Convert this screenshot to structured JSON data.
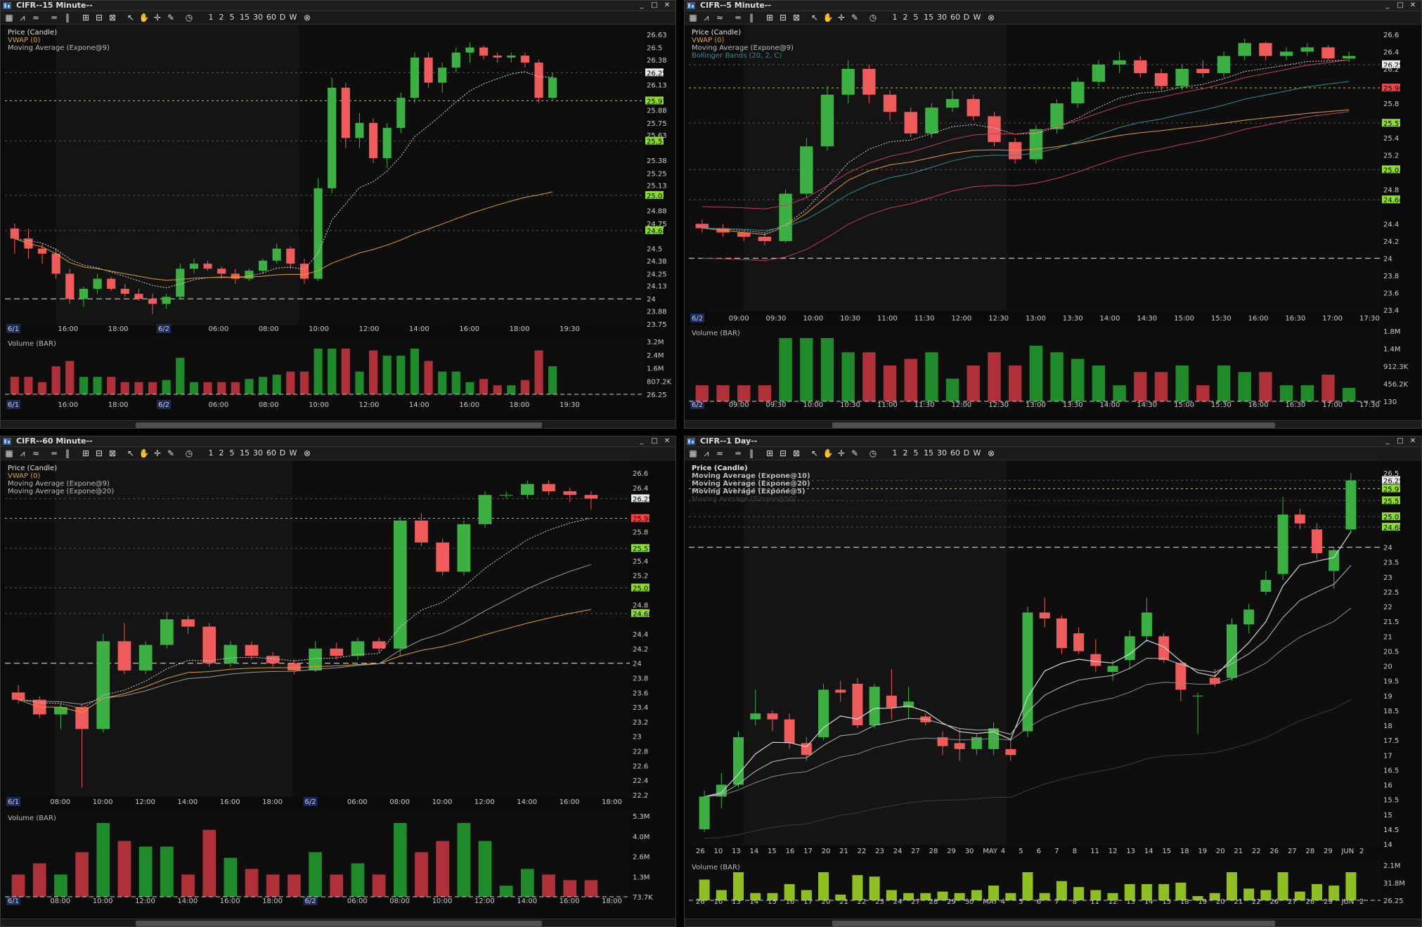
{
  "colors": {
    "up": "#3cb043",
    "down": "#ef5a5a",
    "vwap": "#e0a020",
    "ma9": "#d8d8d8",
    "ma20": "#9a9a9a",
    "bb": "#c0405a",
    "bbmid": "#2f8f8f",
    "price_tag_green": "#8cde2a",
    "price_tag_red": "#ff4040"
  },
  "toolbar": {
    "periods": [
      "1",
      "2",
      "5",
      "15",
      "30",
      "60",
      "D",
      "W"
    ]
  },
  "panes": [
    {
      "title": "CIFR--15 Minute--",
      "legend": [
        "Price (Candle)",
        "VWAP (0)",
        "Moving Average (Expone@9)"
      ],
      "price_ticks": [
        "26.63",
        "26.5",
        "26.38",
        "26.25",
        "26.13",
        "25.97",
        "25.88",
        "25.75",
        "25.63",
        "25.57",
        "25.38",
        "25.25",
        "25.13",
        "25.03",
        "24.88",
        "24.75",
        "24.68",
        "24.5",
        "24.38",
        "24.25",
        "24.13",
        "24",
        "23.88",
        "23.75"
      ],
      "time_labels": [
        "6/1",
        "16:00",
        "18:00",
        "6/2",
        "06:00",
        "08:00",
        "10:00",
        "12:00",
        "14:00",
        "16:00",
        "18:00",
        "19:30"
      ],
      "volume_label": "Volume (BAR)",
      "volume_ticks": [
        "3.2M",
        "2.4M",
        "1.6M",
        "807.2K",
        "26.25"
      ]
    },
    {
      "title": "CIFR--5 Minute--",
      "legend": [
        "Price (Candle)",
        "VWAP (0)",
        "Moving Average (Expone@9)",
        "Bollinger Bands (20, 2, C)"
      ],
      "price_ticks": [
        "26.6",
        "26.4",
        "26.25",
        "26.2",
        "25.98",
        "25.8",
        "25.57",
        "25.4",
        "25.2",
        "25.03",
        "24.8",
        "24.68",
        "24.4",
        "24.2",
        "24",
        "23.8",
        "23.6",
        "23.4"
      ],
      "time_labels": [
        "6/2",
        "09:00",
        "09:30",
        "10:00",
        "10:30",
        "11:00",
        "11:30",
        "12:00",
        "12:30",
        "13:00",
        "13:30",
        "14:00",
        "14:30",
        "15:00",
        "15:30",
        "16:00",
        "16:30",
        "17:00",
        "17:30"
      ],
      "volume_label": "Volume (BAR)",
      "volume_ticks": [
        "1.8M",
        "1.4M",
        "912.3K",
        "456.2K",
        "130"
      ]
    },
    {
      "title": "CIFR--60 Minute--",
      "legend": [
        "Price (Candle)",
        "VWAP (0)",
        "Moving Average (Expone@9)",
        "Moving Average (Expone@20)"
      ],
      "price_ticks": [
        "26.6",
        "26.4",
        "26.25",
        "25.98",
        "25.8",
        "25.57",
        "25.4",
        "25.2",
        "25.03",
        "24.8",
        "24.68",
        "24.4",
        "24.2",
        "24",
        "23.8",
        "23.6",
        "23.4",
        "23.2",
        "23",
        "22.8",
        "22.6",
        "22.4",
        "22.2"
      ],
      "time_labels": [
        "6/1",
        "08:00",
        "10:00",
        "12:00",
        "14:00",
        "16:00",
        "18:00",
        "6/2",
        "06:00",
        "08:00",
        "10:00",
        "12:00",
        "14:00",
        "16:00",
        "18:00"
      ],
      "volume_label": "Volume (BAR)",
      "volume_ticks": [
        "5.3M",
        "4.0M",
        "2.6M",
        "1.3M",
        "73.7K"
      ]
    },
    {
      "title": "CIFR--1 Day--",
      "legend": [
        "Price (Candle)",
        "Moving Average (Expone@10)",
        "Moving Average (Expone@20)",
        "Moving Average (Expone@5)",
        "Moving Average (Simple@50)"
      ],
      "price_ticks": [
        "26.5",
        "26.25",
        "25.97",
        "25.57",
        "25.03",
        "24.68",
        "24",
        "23.5",
        "23",
        "22.5",
        "22",
        "21.5",
        "21",
        "20.5",
        "20",
        "19.5",
        "19",
        "18.5",
        "18",
        "17.5",
        "17",
        "16.5",
        "16",
        "15.5",
        "15",
        "14.5",
        "14"
      ],
      "time_labels": [
        "26",
        "10",
        "13",
        "14",
        "15",
        "16",
        "17",
        "20",
        "21",
        "22",
        "23",
        "24",
        "27",
        "28",
        "29",
        "30",
        "MAY",
        "4",
        "5",
        "6",
        "7",
        "8",
        "11",
        "12",
        "13",
        "14",
        "15",
        "18",
        "19",
        "20",
        "21",
        "22",
        "26",
        "27",
        "28",
        "29",
        "JUN",
        "2"
      ],
      "volume_label": "Volume (BAR)",
      "volume_ticks": [
        "2.1M",
        "31.8M",
        "26.25"
      ]
    }
  ],
  "chart_data": [
    {
      "type": "candlestick",
      "title": "CIFR--15 Minute--",
      "ylim": [
        23.75,
        26.63
      ],
      "ohlc": [
        [
          24.7,
          24.75,
          24.45,
          24.6
        ],
        [
          24.6,
          24.7,
          24.4,
          24.5
        ],
        [
          24.5,
          24.55,
          24.35,
          24.45
        ],
        [
          24.45,
          24.5,
          24.2,
          24.25
        ],
        [
          24.25,
          24.3,
          23.95,
          24.0
        ],
        [
          24.0,
          24.12,
          23.92,
          24.1
        ],
        [
          24.1,
          24.25,
          24.05,
          24.2
        ],
        [
          24.2,
          24.22,
          24.08,
          24.1
        ],
        [
          24.1,
          24.15,
          24.02,
          24.05
        ],
        [
          24.05,
          24.1,
          23.98,
          24.0
        ],
        [
          24.0,
          24.05,
          23.85,
          23.95
        ],
        [
          23.95,
          24.05,
          23.9,
          24.02
        ],
        [
          24.02,
          24.35,
          24.0,
          24.3
        ],
        [
          24.3,
          24.4,
          24.25,
          24.35
        ],
        [
          24.35,
          24.38,
          24.28,
          24.3
        ],
        [
          24.3,
          24.32,
          24.2,
          24.25
        ],
        [
          24.25,
          24.3,
          24.15,
          24.2
        ],
        [
          24.2,
          24.3,
          24.18,
          24.28
        ],
        [
          24.28,
          24.4,
          24.25,
          24.38
        ],
        [
          24.38,
          24.55,
          24.35,
          24.5
        ],
        [
          24.5,
          24.52,
          24.3,
          24.35
        ],
        [
          24.35,
          24.4,
          24.15,
          24.2
        ],
        [
          24.2,
          25.2,
          24.18,
          25.1
        ],
        [
          25.1,
          26.2,
          25.05,
          26.1
        ],
        [
          26.1,
          26.15,
          25.5,
          25.6
        ],
        [
          25.6,
          25.85,
          25.5,
          25.75
        ],
        [
          25.75,
          25.8,
          25.35,
          25.4
        ],
        [
          25.4,
          25.75,
          25.3,
          25.7
        ],
        [
          25.7,
          26.05,
          25.65,
          26.0
        ],
        [
          26.0,
          26.45,
          25.95,
          26.4
        ],
        [
          26.4,
          26.45,
          26.1,
          26.15
        ],
        [
          26.15,
          26.35,
          26.05,
          26.3
        ],
        [
          26.3,
          26.5,
          26.25,
          26.45
        ],
        [
          26.45,
          26.55,
          26.35,
          26.5
        ],
        [
          26.5,
          26.52,
          26.38,
          26.42
        ],
        [
          26.42,
          26.45,
          26.35,
          26.4
        ],
        [
          26.4,
          26.45,
          26.35,
          26.42
        ],
        [
          26.42,
          26.45,
          26.3,
          26.35
        ],
        [
          26.35,
          26.38,
          25.95,
          26.0
        ],
        [
          26.0,
          26.25,
          25.98,
          26.2
        ]
      ]
    },
    {
      "type": "candlestick",
      "title": "CIFR--5 Minute--",
      "ylim": [
        23.4,
        26.6
      ],
      "ohlc": [
        [
          24.4,
          24.45,
          24.3,
          24.35
        ],
        [
          24.35,
          24.4,
          24.25,
          24.3
        ],
        [
          24.3,
          24.32,
          24.2,
          24.25
        ],
        [
          24.25,
          24.3,
          24.15,
          24.2
        ],
        [
          24.2,
          24.8,
          24.18,
          24.75
        ],
        [
          24.75,
          25.4,
          24.7,
          25.3
        ],
        [
          25.3,
          26.0,
          25.25,
          25.9
        ],
        [
          25.9,
          26.3,
          25.8,
          26.2
        ],
        [
          26.2,
          26.25,
          25.8,
          25.9
        ],
        [
          25.9,
          25.95,
          25.6,
          25.7
        ],
        [
          25.7,
          25.75,
          25.4,
          25.45
        ],
        [
          25.45,
          25.8,
          25.4,
          25.75
        ],
        [
          25.75,
          25.95,
          25.7,
          25.85
        ],
        [
          25.85,
          25.9,
          25.6,
          25.65
        ],
        [
          25.65,
          25.7,
          25.3,
          25.35
        ],
        [
          25.35,
          25.4,
          25.1,
          25.15
        ],
        [
          25.15,
          25.55,
          25.1,
          25.5
        ],
        [
          25.5,
          25.85,
          25.45,
          25.8
        ],
        [
          25.8,
          26.1,
          25.75,
          26.05
        ],
        [
          26.05,
          26.3,
          26.0,
          26.25
        ],
        [
          26.25,
          26.4,
          26.15,
          26.3
        ],
        [
          26.3,
          26.35,
          26.1,
          26.15
        ],
        [
          26.15,
          26.2,
          25.95,
          26.0
        ],
        [
          26.0,
          26.25,
          25.95,
          26.2
        ],
        [
          26.2,
          26.3,
          26.1,
          26.15
        ],
        [
          26.15,
          26.4,
          26.1,
          26.35
        ],
        [
          26.35,
          26.55,
          26.3,
          26.5
        ],
        [
          26.5,
          26.52,
          26.3,
          26.35
        ],
        [
          26.35,
          26.45,
          26.3,
          26.4
        ],
        [
          26.4,
          26.5,
          26.35,
          26.45
        ],
        [
          26.45,
          26.48,
          26.3,
          26.32
        ],
        [
          26.32,
          26.4,
          26.28,
          26.35
        ]
      ]
    },
    {
      "type": "candlestick",
      "title": "CIFR--60 Minute--",
      "ylim": [
        22.2,
        26.6
      ],
      "ohlc": [
        [
          23.6,
          23.7,
          23.45,
          23.5
        ],
        [
          23.5,
          23.55,
          23.25,
          23.3
        ],
        [
          23.3,
          23.45,
          23.1,
          23.4
        ],
        [
          23.4,
          23.45,
          22.3,
          23.1
        ],
        [
          23.1,
          24.4,
          23.05,
          24.3
        ],
        [
          24.3,
          24.55,
          23.85,
          23.9
        ],
        [
          23.9,
          24.3,
          23.85,
          24.25
        ],
        [
          24.25,
          24.7,
          24.2,
          24.6
        ],
        [
          24.6,
          24.65,
          24.4,
          24.5
        ],
        [
          24.5,
          24.55,
          23.95,
          24.0
        ],
        [
          24.0,
          24.3,
          23.95,
          24.25
        ],
        [
          24.25,
          24.3,
          24.05,
          24.1
        ],
        [
          24.1,
          24.15,
          23.95,
          24.0
        ],
        [
          24.0,
          24.05,
          23.85,
          23.9
        ],
        [
          23.9,
          24.3,
          23.88,
          24.2
        ],
        [
          24.2,
          24.28,
          24.05,
          24.1
        ],
        [
          24.1,
          24.35,
          24.05,
          24.3
        ],
        [
          24.3,
          24.35,
          24.15,
          24.2
        ],
        [
          24.2,
          26.0,
          24.1,
          25.95
        ],
        [
          25.95,
          26.05,
          25.6,
          25.65
        ],
        [
          25.65,
          25.7,
          25.2,
          25.25
        ],
        [
          25.25,
          25.95,
          25.2,
          25.9
        ],
        [
          25.9,
          26.35,
          25.85,
          26.3
        ],
        [
          26.3,
          26.35,
          26.25,
          26.3
        ],
        [
          26.3,
          26.5,
          26.25,
          26.45
        ],
        [
          26.45,
          26.5,
          26.3,
          26.35
        ],
        [
          26.35,
          26.4,
          26.2,
          26.3
        ],
        [
          26.3,
          26.35,
          26.1,
          26.25
        ]
      ]
    },
    {
      "type": "candlestick",
      "title": "CIFR--1 Day--",
      "ylim": [
        14.0,
        26.5
      ],
      "ohlc": [
        [
          14.5,
          15.8,
          14.4,
          15.6
        ],
        [
          15.6,
          16.4,
          15.2,
          16.0
        ],
        [
          16.0,
          17.8,
          15.9,
          17.6
        ],
        [
          18.2,
          19.2,
          18.0,
          18.4
        ],
        [
          18.4,
          18.5,
          17.8,
          18.2
        ],
        [
          18.2,
          18.4,
          17.2,
          17.4
        ],
        [
          17.4,
          17.6,
          16.8,
          17.0
        ],
        [
          17.6,
          19.4,
          17.5,
          19.2
        ],
        [
          19.2,
          19.5,
          18.8,
          19.1
        ],
        [
          19.4,
          19.6,
          17.9,
          18.0
        ],
        [
          18.0,
          19.4,
          17.9,
          19.3
        ],
        [
          19.0,
          19.9,
          18.2,
          18.6
        ],
        [
          18.6,
          19.3,
          18.2,
          18.8
        ],
        [
          18.3,
          18.4,
          18.0,
          18.1
        ],
        [
          17.6,
          17.8,
          17.0,
          17.3
        ],
        [
          17.4,
          17.9,
          16.8,
          17.2
        ],
        [
          17.2,
          17.7,
          17.0,
          17.6
        ],
        [
          17.2,
          18.1,
          17.0,
          17.9
        ],
        [
          17.2,
          17.5,
          16.8,
          17.0
        ],
        [
          17.8,
          22.0,
          17.6,
          21.8
        ],
        [
          21.8,
          22.3,
          21.3,
          21.6
        ],
        [
          21.6,
          21.7,
          20.4,
          20.6
        ],
        [
          21.1,
          21.3,
          20.4,
          20.5
        ],
        [
          20.4,
          20.9,
          19.8,
          20.0
        ],
        [
          19.8,
          20.2,
          19.5,
          20.0
        ],
        [
          20.2,
          21.2,
          19.9,
          21.0
        ],
        [
          21.0,
          22.3,
          20.8,
          21.8
        ],
        [
          21.0,
          21.1,
          20.1,
          20.2
        ],
        [
          20.1,
          20.2,
          18.8,
          19.2
        ],
        [
          19.0,
          19.1,
          17.7,
          19.0
        ],
        [
          19.6,
          19.9,
          19.3,
          19.4
        ],
        [
          19.6,
          21.6,
          19.5,
          21.4
        ],
        [
          21.4,
          22.1,
          21.1,
          21.9
        ],
        [
          22.5,
          23.2,
          22.4,
          22.9
        ],
        [
          23.1,
          25.7,
          22.9,
          25.1
        ],
        [
          25.1,
          25.3,
          24.6,
          24.8
        ],
        [
          24.6,
          24.8,
          23.6,
          23.8
        ],
        [
          23.2,
          24.0,
          22.6,
          23.9
        ],
        [
          24.6,
          26.5,
          24.5,
          26.25
        ]
      ]
    }
  ]
}
